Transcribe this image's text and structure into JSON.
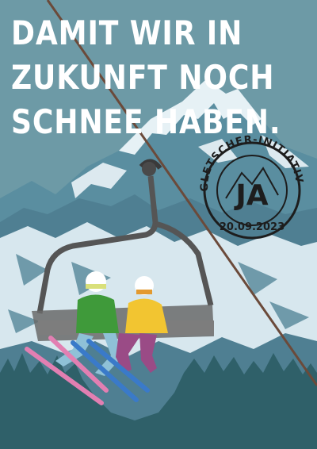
{
  "headline": {
    "line1": "DAMIT WIR IN",
    "line2": "ZUKUNFT NOCH",
    "line3": "SCHNEE HABEN."
  },
  "stamp": {
    "arc_text": "GLETSCHER-INITIATIVE",
    "vote": "JA",
    "date": "20.09.2023"
  },
  "colors": {
    "sky": "#6d9aa6",
    "snow": "#e6f1f5",
    "rock": "#4f7f92",
    "forest": "#2f6069",
    "jacket_green": "#3f9a3a",
    "jacket_yellow": "#f2c531",
    "ski_pink": "#e27fb2",
    "ski_blue": "#3a7ac9"
  }
}
